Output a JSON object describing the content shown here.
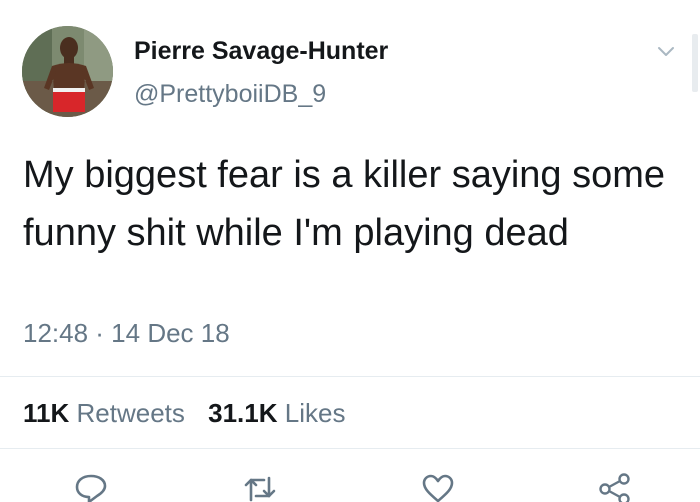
{
  "author": {
    "display_name": "Pierre Savage-Hunter",
    "handle": "@PrettyboiiDB_9"
  },
  "tweet": {
    "text": "My biggest fear is a killer saying some funny shit while I'm playing dead",
    "timestamp": "12:48 · 14 Dec 18"
  },
  "stats": {
    "retweets_count": "11K",
    "retweets_label": "Retweets",
    "likes_count": "31.1K",
    "likes_label": "Likes"
  },
  "actions": {
    "icons": [
      "reply-icon",
      "retweet-icon",
      "like-icon",
      "share-icon"
    ]
  },
  "colors": {
    "text": "#14171a",
    "secondary": "#657786",
    "divider": "#e6ecf0"
  }
}
